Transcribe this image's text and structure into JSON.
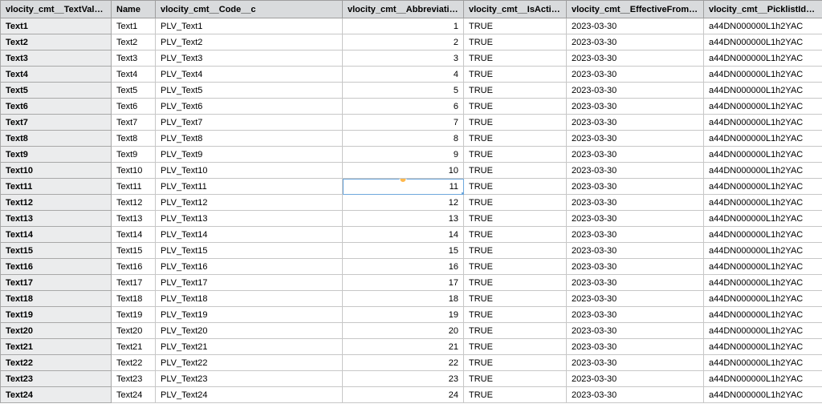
{
  "columns": [
    "vlocity_cmt__TextValue__c",
    "Name",
    "vlocity_cmt__Code__c",
    "vlocity_cmt__Abbreviation__c",
    "vlocity_cmt__IsActive__c",
    "vlocity_cmt__EffectiveFromDate__c",
    "vlocity_cmt__PicklistId__c"
  ],
  "selected_cell": {
    "row": 10,
    "col": 3
  },
  "rows": [
    {
      "textvalue": "Text1",
      "name": "Text1",
      "code": "PLV_Text1",
      "abbr": "1",
      "active": "TRUE",
      "date": "2023-03-30",
      "picklist": "a44DN000000L1h2YAC"
    },
    {
      "textvalue": "Text2",
      "name": "Text2",
      "code": "PLV_Text2",
      "abbr": "2",
      "active": "TRUE",
      "date": "2023-03-30",
      "picklist": "a44DN000000L1h2YAC"
    },
    {
      "textvalue": "Text3",
      "name": "Text3",
      "code": "PLV_Text3",
      "abbr": "3",
      "active": "TRUE",
      "date": "2023-03-30",
      "picklist": "a44DN000000L1h2YAC"
    },
    {
      "textvalue": "Text4",
      "name": "Text4",
      "code": "PLV_Text4",
      "abbr": "4",
      "active": "TRUE",
      "date": "2023-03-30",
      "picklist": "a44DN000000L1h2YAC"
    },
    {
      "textvalue": "Text5",
      "name": "Text5",
      "code": "PLV_Text5",
      "abbr": "5",
      "active": "TRUE",
      "date": "2023-03-30",
      "picklist": "a44DN000000L1h2YAC"
    },
    {
      "textvalue": "Text6",
      "name": "Text6",
      "code": "PLV_Text6",
      "abbr": "6",
      "active": "TRUE",
      "date": "2023-03-30",
      "picklist": "a44DN000000L1h2YAC"
    },
    {
      "textvalue": "Text7",
      "name": "Text7",
      "code": "PLV_Text7",
      "abbr": "7",
      "active": "TRUE",
      "date": "2023-03-30",
      "picklist": "a44DN000000L1h2YAC"
    },
    {
      "textvalue": "Text8",
      "name": "Text8",
      "code": "PLV_Text8",
      "abbr": "8",
      "active": "TRUE",
      "date": "2023-03-30",
      "picklist": "a44DN000000L1h2YAC"
    },
    {
      "textvalue": "Text9",
      "name": "Text9",
      "code": "PLV_Text9",
      "abbr": "9",
      "active": "TRUE",
      "date": "2023-03-30",
      "picklist": "a44DN000000L1h2YAC"
    },
    {
      "textvalue": "Text10",
      "name": "Text10",
      "code": "PLV_Text10",
      "abbr": "10",
      "active": "TRUE",
      "date": "2023-03-30",
      "picklist": "a44DN000000L1h2YAC"
    },
    {
      "textvalue": "Text11",
      "name": "Text11",
      "code": "PLV_Text11",
      "abbr": "11",
      "active": "TRUE",
      "date": "2023-03-30",
      "picklist": "a44DN000000L1h2YAC"
    },
    {
      "textvalue": "Text12",
      "name": "Text12",
      "code": "PLV_Text12",
      "abbr": "12",
      "active": "TRUE",
      "date": "2023-03-30",
      "picklist": "a44DN000000L1h2YAC"
    },
    {
      "textvalue": "Text13",
      "name": "Text13",
      "code": "PLV_Text13",
      "abbr": "13",
      "active": "TRUE",
      "date": "2023-03-30",
      "picklist": "a44DN000000L1h2YAC"
    },
    {
      "textvalue": "Text14",
      "name": "Text14",
      "code": "PLV_Text14",
      "abbr": "14",
      "active": "TRUE",
      "date": "2023-03-30",
      "picklist": "a44DN000000L1h2YAC"
    },
    {
      "textvalue": "Text15",
      "name": "Text15",
      "code": "PLV_Text15",
      "abbr": "15",
      "active": "TRUE",
      "date": "2023-03-30",
      "picklist": "a44DN000000L1h2YAC"
    },
    {
      "textvalue": "Text16",
      "name": "Text16",
      "code": "PLV_Text16",
      "abbr": "16",
      "active": "TRUE",
      "date": "2023-03-30",
      "picklist": "a44DN000000L1h2YAC"
    },
    {
      "textvalue": "Text17",
      "name": "Text17",
      "code": "PLV_Text17",
      "abbr": "17",
      "active": "TRUE",
      "date": "2023-03-30",
      "picklist": "a44DN000000L1h2YAC"
    },
    {
      "textvalue": "Text18",
      "name": "Text18",
      "code": "PLV_Text18",
      "abbr": "18",
      "active": "TRUE",
      "date": "2023-03-30",
      "picklist": "a44DN000000L1h2YAC"
    },
    {
      "textvalue": "Text19",
      "name": "Text19",
      "code": "PLV_Text19",
      "abbr": "19",
      "active": "TRUE",
      "date": "2023-03-30",
      "picklist": "a44DN000000L1h2YAC"
    },
    {
      "textvalue": "Text20",
      "name": "Text20",
      "code": "PLV_Text20",
      "abbr": "20",
      "active": "TRUE",
      "date": "2023-03-30",
      "picklist": "a44DN000000L1h2YAC"
    },
    {
      "textvalue": "Text21",
      "name": "Text21",
      "code": "PLV_Text21",
      "abbr": "21",
      "active": "TRUE",
      "date": "2023-03-30",
      "picklist": "a44DN000000L1h2YAC"
    },
    {
      "textvalue": "Text22",
      "name": "Text22",
      "code": "PLV_Text22",
      "abbr": "22",
      "active": "TRUE",
      "date": "2023-03-30",
      "picklist": "a44DN000000L1h2YAC"
    },
    {
      "textvalue": "Text23",
      "name": "Text23",
      "code": "PLV_Text23",
      "abbr": "23",
      "active": "TRUE",
      "date": "2023-03-30",
      "picklist": "a44DN000000L1h2YAC"
    },
    {
      "textvalue": "Text24",
      "name": "Text24",
      "code": "PLV_Text24",
      "abbr": "24",
      "active": "TRUE",
      "date": "2023-03-30",
      "picklist": "a44DN000000L1h2YAC"
    }
  ]
}
